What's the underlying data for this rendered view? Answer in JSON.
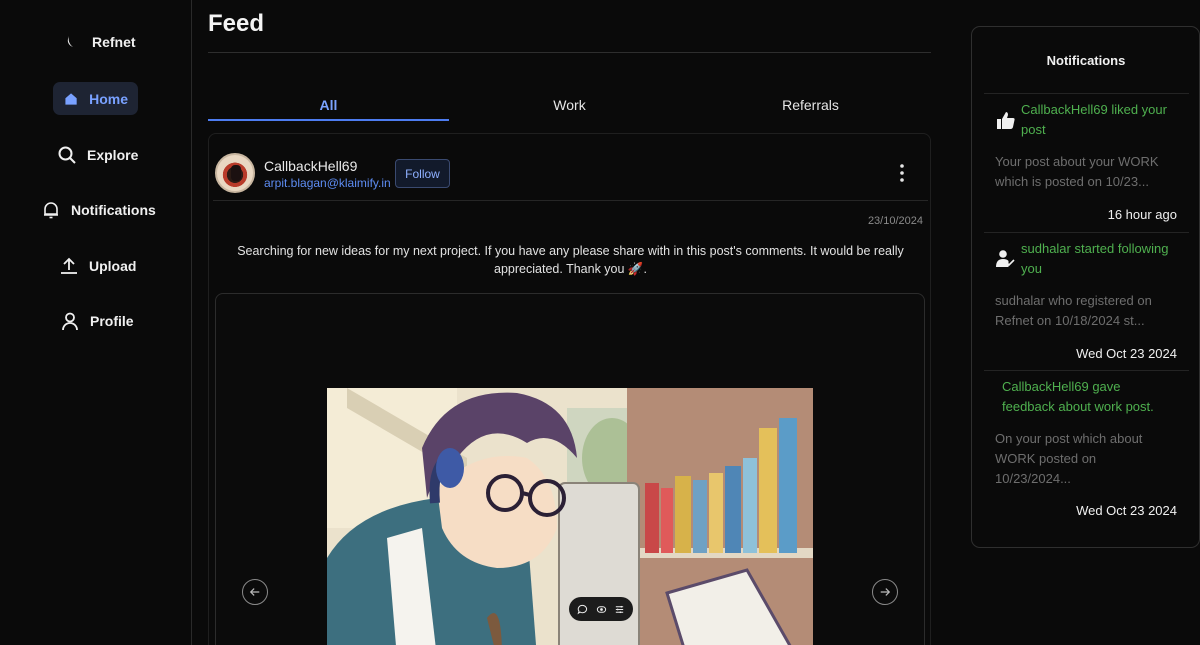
{
  "sidebar": {
    "brand": "Refnet",
    "items": [
      {
        "label": "Home",
        "icon": "home-icon",
        "active": true
      },
      {
        "label": "Explore",
        "icon": "search-icon"
      },
      {
        "label": "Notifications",
        "icon": "bell-icon"
      },
      {
        "label": "Upload",
        "icon": "upload-icon"
      },
      {
        "label": "Profile",
        "icon": "user-icon"
      }
    ]
  },
  "main": {
    "title": "Feed",
    "tabs": [
      {
        "label": "All",
        "active": true
      },
      {
        "label": "Work"
      },
      {
        "label": "Referrals"
      }
    ],
    "post": {
      "author": "CallbackHell69",
      "email": "arpit.blagan@klaimify.in",
      "follow_label": "Follow",
      "date": "23/10/2024",
      "text": "Searching for new ideas for my next project. If you have any please share with in this post's comments. It would be really appreciated. Thank you 🚀."
    }
  },
  "notifications": {
    "title": "Notifications",
    "items": [
      {
        "head": "CallbackHell69 liked your post",
        "body": "Your post about your WORK which is posted on 10/23...",
        "time": "16 hour ago",
        "icon": "thumbs-up-icon"
      },
      {
        "head": "sudhalar started following you",
        "body": "sudhalar who registered on Refnet on 10/18/2024 st...",
        "time": "Wed Oct 23 2024",
        "icon": "user-check-icon"
      },
      {
        "head": "CallbackHell69 gave feedback about work post.",
        "body": "On your post which about WORK posted on 10/23/2024...",
        "time": "Wed Oct 23 2024",
        "icon": "none"
      }
    ]
  },
  "colors": {
    "accent": "#7ba3ff",
    "notification_head": "#4fb04f",
    "background": "#0a0a0a"
  }
}
